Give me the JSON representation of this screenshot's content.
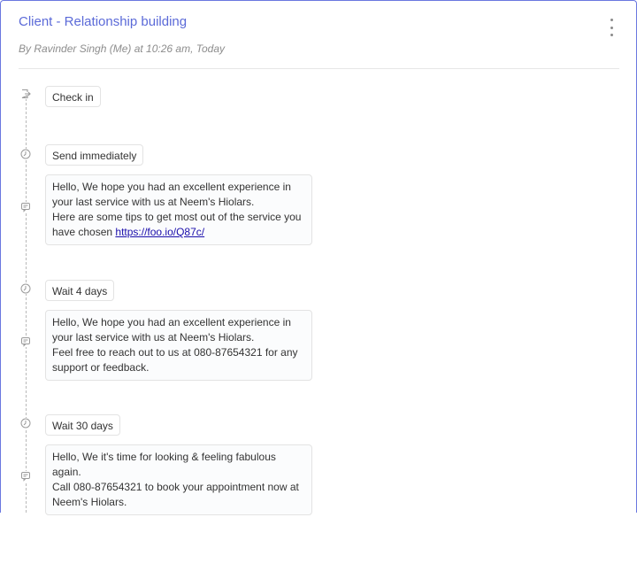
{
  "card": {
    "title": "Client - Relationship building",
    "byline": "By Ravinder Singh (Me) at 10:26 am, Today",
    "menu_icon": "kebab-menu-icon"
  },
  "steps": {
    "check_in": {
      "label": "Check in",
      "icon": "check-in-icon"
    },
    "step1": {
      "delay": "Send immediately",
      "delay_icon": "clock-icon",
      "message_icon": "chat-icon",
      "lines": [
        "Hello, We hope you had an excellent experience in your last service with us at Neem's Hiolars.",
        "Here are some tips to get most out of the service you have chosen "
      ],
      "link": "https://foo.io/Q87c/"
    },
    "step2": {
      "delay": "Wait 4 days",
      "delay_icon": "clock-icon",
      "message_icon": "chat-icon",
      "lines": [
        "Hello, We hope you had an excellent experience in your last service with us at Neem's Hiolars.",
        "Feel free to reach out to us at 080-87654321 for any support or feedback."
      ]
    },
    "step3": {
      "delay": "Wait 30 days",
      "delay_icon": "clock-icon",
      "message_icon": "chat-icon",
      "lines": [
        "Hello, We it's time for looking & feeling fabulous again.",
        "Call 080-87654321 to book your appointment now at Neem's Hiolars."
      ]
    }
  },
  "colors": {
    "accent": "#5b6ad8",
    "border": "#6a78e0",
    "link": "#1a0dab"
  }
}
